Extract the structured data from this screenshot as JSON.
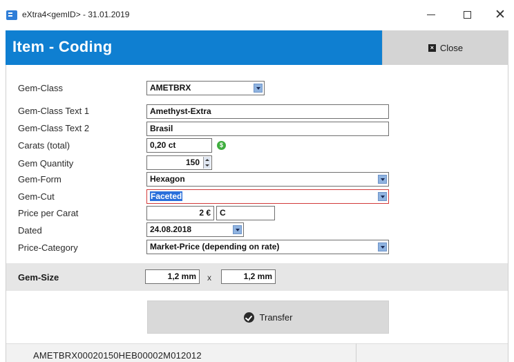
{
  "window": {
    "title": "eXtra4<gemID>  -  31.01.2019",
    "close_glyph": "✕"
  },
  "header": {
    "title": "Item - Coding",
    "close_label": "Close"
  },
  "form": {
    "gem_class": {
      "label": "Gem-Class",
      "value": "AMETBRX"
    },
    "gem_class_text1": {
      "label": "Gem-Class Text 1",
      "value": "Amethyst-Extra"
    },
    "gem_class_text2": {
      "label": "Gem-Class Text 2",
      "value": "Brasil"
    },
    "carats": {
      "label": "Carats (total)",
      "value": "0,20 ct",
      "icon": "dollar-icon"
    },
    "gem_quantity": {
      "label": "Gem Quantity",
      "value": "150"
    },
    "gem_form": {
      "label": "Gem-Form",
      "value": "Hexagon"
    },
    "gem_cut": {
      "label": "Gem-Cut",
      "value": "Faceted"
    },
    "price_per_carat": {
      "label": "Price per Carat",
      "value": "2 €",
      "currency_code": "C"
    },
    "dated": {
      "label": "Dated",
      "value": "24.08.2018"
    },
    "price_category": {
      "label": "Price-Category",
      "value": "Market-Price (depending on rate)"
    }
  },
  "gem_size": {
    "label": "Gem-Size",
    "width": "1,2 mm",
    "separator": "x",
    "height": "1,2 mm"
  },
  "transfer": {
    "label": "Transfer"
  },
  "status": {
    "code": "AMETBRX00020150HEB00002M012012"
  },
  "colors": {
    "header_bg": "#0f7fd1",
    "selection": "#2a6fdb",
    "error_border": "#d23a3a",
    "dollar_icon": "#3fae3f"
  }
}
